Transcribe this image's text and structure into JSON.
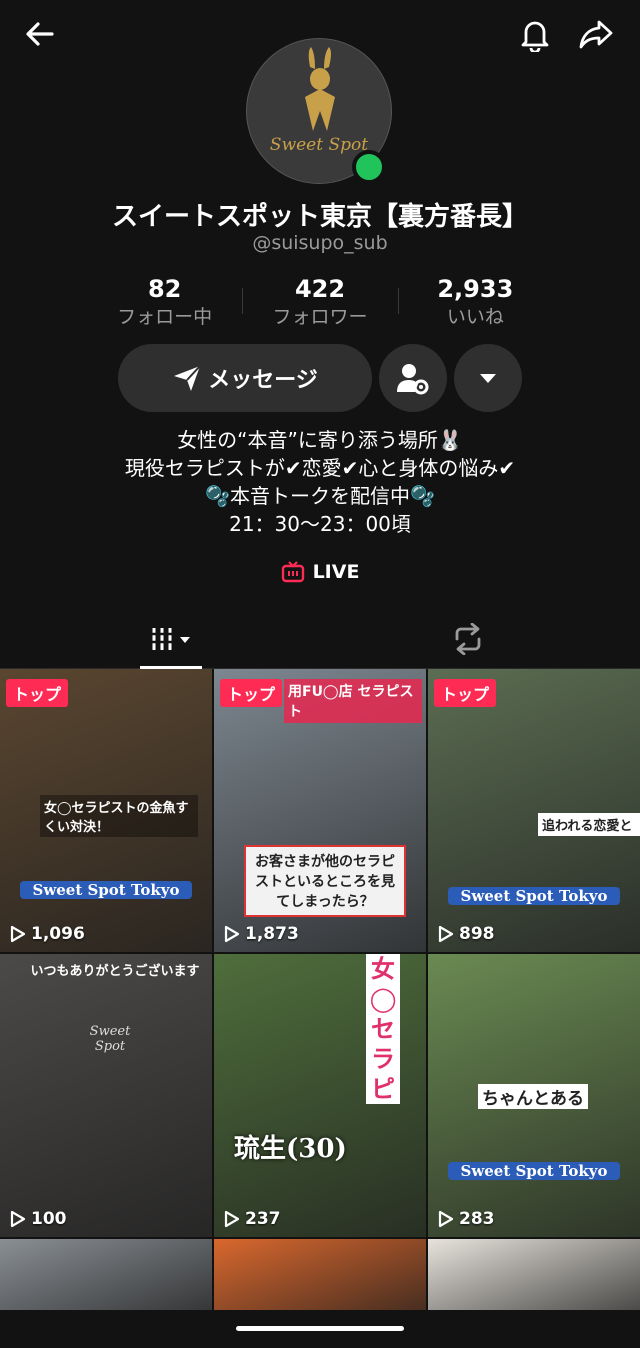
{
  "profile": {
    "display_name": "スイートスポット東京【裏方番長】",
    "handle": "@suisupo_sub",
    "avatar_text": "Sweet Spot"
  },
  "stats": [
    {
      "value": "82",
      "label": "フォロー中"
    },
    {
      "value": "422",
      "label": "フォロワー"
    },
    {
      "value": "2,933",
      "label": "いいね"
    }
  ],
  "actions": {
    "message_label": "メッセージ"
  },
  "bio": {
    "line1": "女性の“本音”に寄り添う場所🐰",
    "line2": "現役セラピストが✔恋愛✔心と身体の悩み✔",
    "line3": "🫧本音トークを配信中🫧",
    "line4": "21：30〜23：00頃"
  },
  "live_label": "LIVE",
  "videos": [
    {
      "badge": "トップ",
      "views": "1,096",
      "caption": "女◯セラピストの金魚すくい対決！",
      "brand": "Sweet Spot Tokyo",
      "bg": "#5a4630"
    },
    {
      "badge": "トップ",
      "views": "1,873",
      "caption": "お客さまが他のセラピストといるところを見てしまったら？",
      "brand": "用FU◯店 セラピスト",
      "bg": "#7d8790"
    },
    {
      "badge": "トップ",
      "views": "898",
      "caption": "追われる恋愛と",
      "brand": "Sweet Spot Tokyo",
      "bg": "#5b6d52"
    },
    {
      "badge": "",
      "views": "100",
      "caption": "いつもありがとうございます",
      "brand": "Sweet Spot",
      "bg": "#4c4a48"
    },
    {
      "badge": "",
      "views": "237",
      "caption": "琉生(30)",
      "brand": "女◯セラピ",
      "bg": "#4f6e3c"
    },
    {
      "badge": "",
      "views": "283",
      "caption": "ちゃんとある",
      "brand": "Sweet Spot Tokyo",
      "bg": "#6a8a52"
    },
    {
      "badge": "",
      "views": "",
      "caption": "",
      "brand": "",
      "bg": "#8a8f94"
    },
    {
      "badge": "",
      "views": "",
      "caption": "",
      "brand": "",
      "bg": "#d9682e"
    },
    {
      "badge": "",
      "views": "",
      "caption": "",
      "brand": "",
      "bg": "#e7e3dc"
    }
  ],
  "icons": {
    "back": "arrow-left-icon",
    "bell": "bell-icon",
    "share": "share-icon",
    "message": "send-icon",
    "add_friend": "user-settings-icon",
    "more": "chevron-down-icon",
    "live": "live-tv-icon",
    "grid_tab": "grid-icon",
    "repost_tab": "repost-icon",
    "play": "play-icon"
  },
  "colors": {
    "background": "#121212",
    "accent": "#fe2c55",
    "online": "#21c45a",
    "secondary_text": "#9a9a9a"
  }
}
